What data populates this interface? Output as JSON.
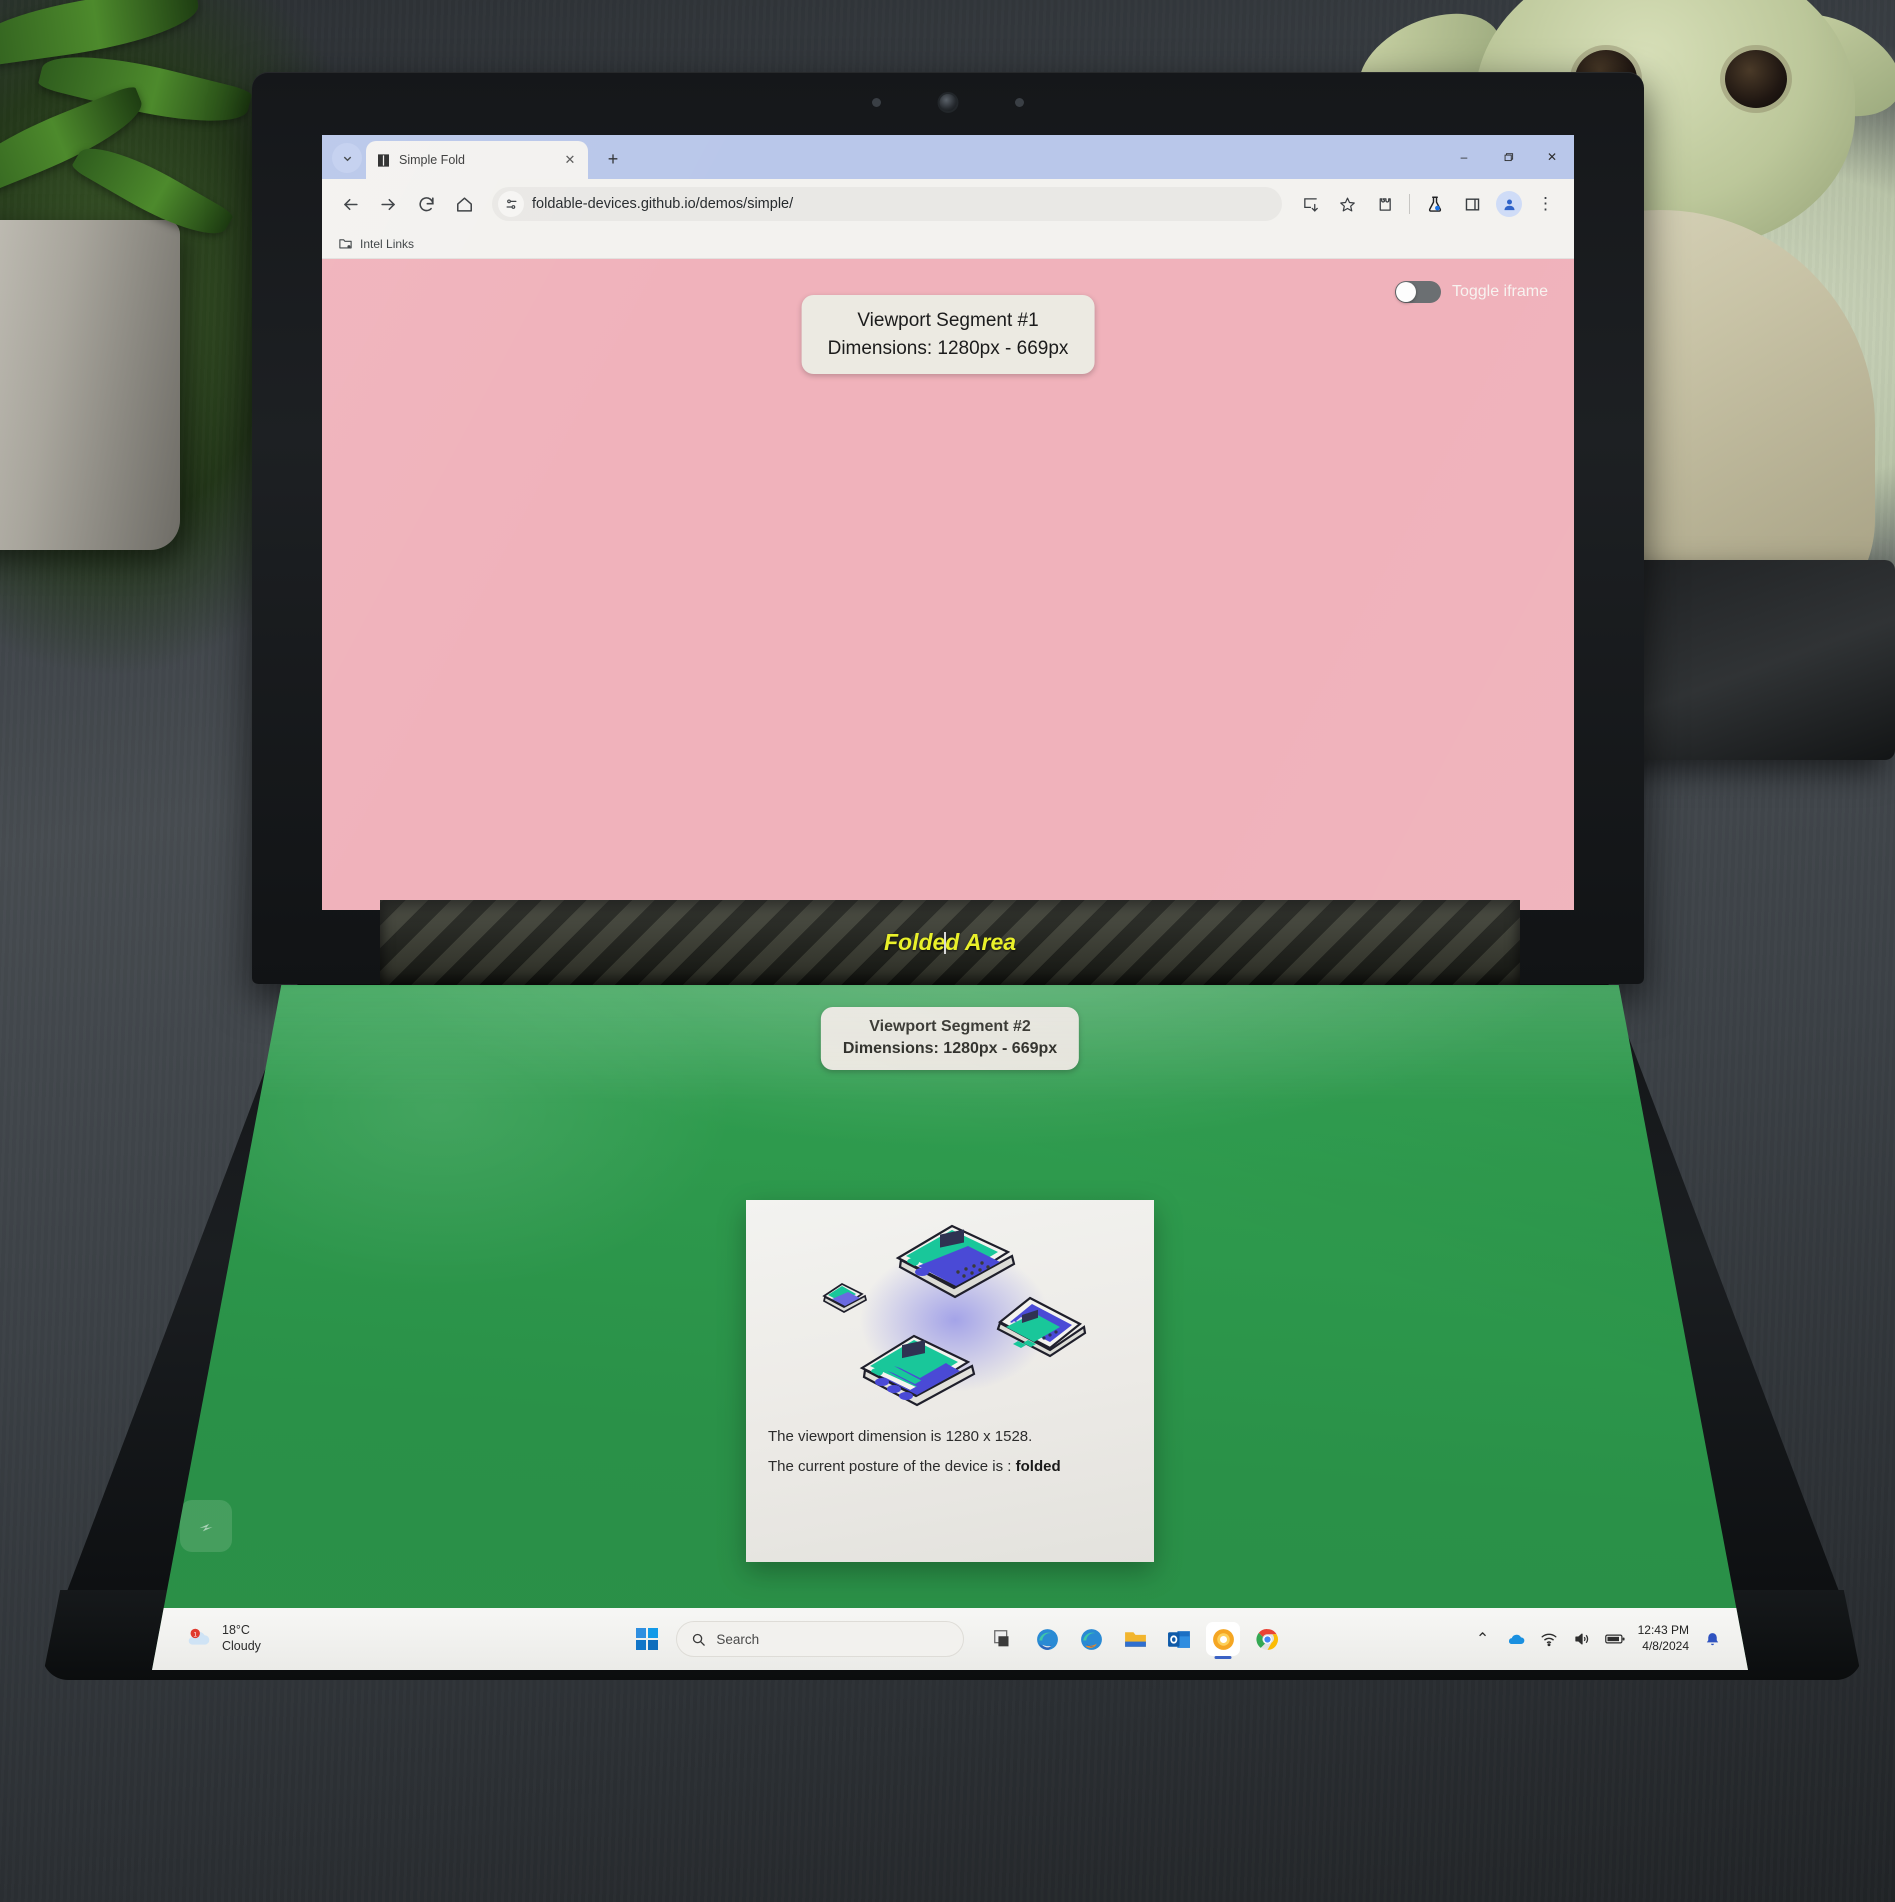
{
  "browser": {
    "window_controls": {
      "minimize": "–",
      "maximize": "❐",
      "close": "✕"
    },
    "tab_list_chevron_icon": "chevron-down-icon",
    "tabs": [
      {
        "title": "Simple Fold",
        "favicon": "book-icon",
        "close_label": "✕"
      }
    ],
    "new_tab_label": "+",
    "nav": {
      "back_label": "←",
      "forward_label": "→",
      "reload_label": "⟳",
      "home_label": "⌂"
    },
    "omnibox": {
      "site_info_icon": "tune-icon",
      "url": "foldable-devices.github.io/demos/simple/"
    },
    "actions": {
      "install_label": "install-icon",
      "bookmark_label": "star-icon",
      "extensions_label": "puzzle-icon",
      "experiments_label": "flask-icon",
      "side_panel_label": "side-panel-icon",
      "profile_label": "profile-avatar",
      "menu_label": "⋮"
    },
    "bookmarks": [
      {
        "label": "Intel Links",
        "icon": "managed-folder-icon"
      }
    ]
  },
  "page": {
    "segment1": {
      "title": "Viewport Segment #1",
      "dimensions": "Dimensions: 1280px - 669px",
      "bg_color": "#f0b2bb"
    },
    "toggle_iframe": {
      "label": "Toggle iframe",
      "state": "off"
    },
    "folded_area": {
      "label": "Folded Area",
      "color": "#e9f02a"
    },
    "segment2": {
      "title": "Viewport Segment #2",
      "dimensions": "Dimensions: 1280px - 669px",
      "bg_color": "#2e9a4d"
    },
    "card": {
      "illustration": "isometric-foldable-laptops-illustration",
      "viewport_line": "The viewport dimension is 1280 x 1528.",
      "posture_prefix": "The current posture of the device is : ",
      "posture_value": "folded"
    }
  },
  "taskbar": {
    "weather": {
      "temp": "18°C",
      "condition": "Cloudy",
      "icon": "weather-cloud-icon"
    },
    "start_label": "start-button",
    "search_placeholder": "Search",
    "apps": [
      {
        "name": "task-view",
        "icon": "task-view-icon"
      },
      {
        "name": "microsoft-edge",
        "icon": "edge-icon"
      },
      {
        "name": "microsoft-edge-dev",
        "icon": "edge-dev-icon"
      },
      {
        "name": "file-explorer",
        "icon": "folder-icon"
      },
      {
        "name": "outlook",
        "icon": "outlook-icon"
      },
      {
        "name": "chrome-canary",
        "icon": "chrome-canary-icon"
      },
      {
        "name": "google-chrome",
        "icon": "chrome-icon"
      }
    ],
    "tray": {
      "overflow_label": "⌃",
      "onedrive": "onedrive-icon",
      "wifi": "wifi-icon",
      "volume": "volume-icon",
      "battery": "battery-icon",
      "time": "12:43 PM",
      "date": "4/8/2024",
      "notifications": "bell-icon"
    }
  }
}
